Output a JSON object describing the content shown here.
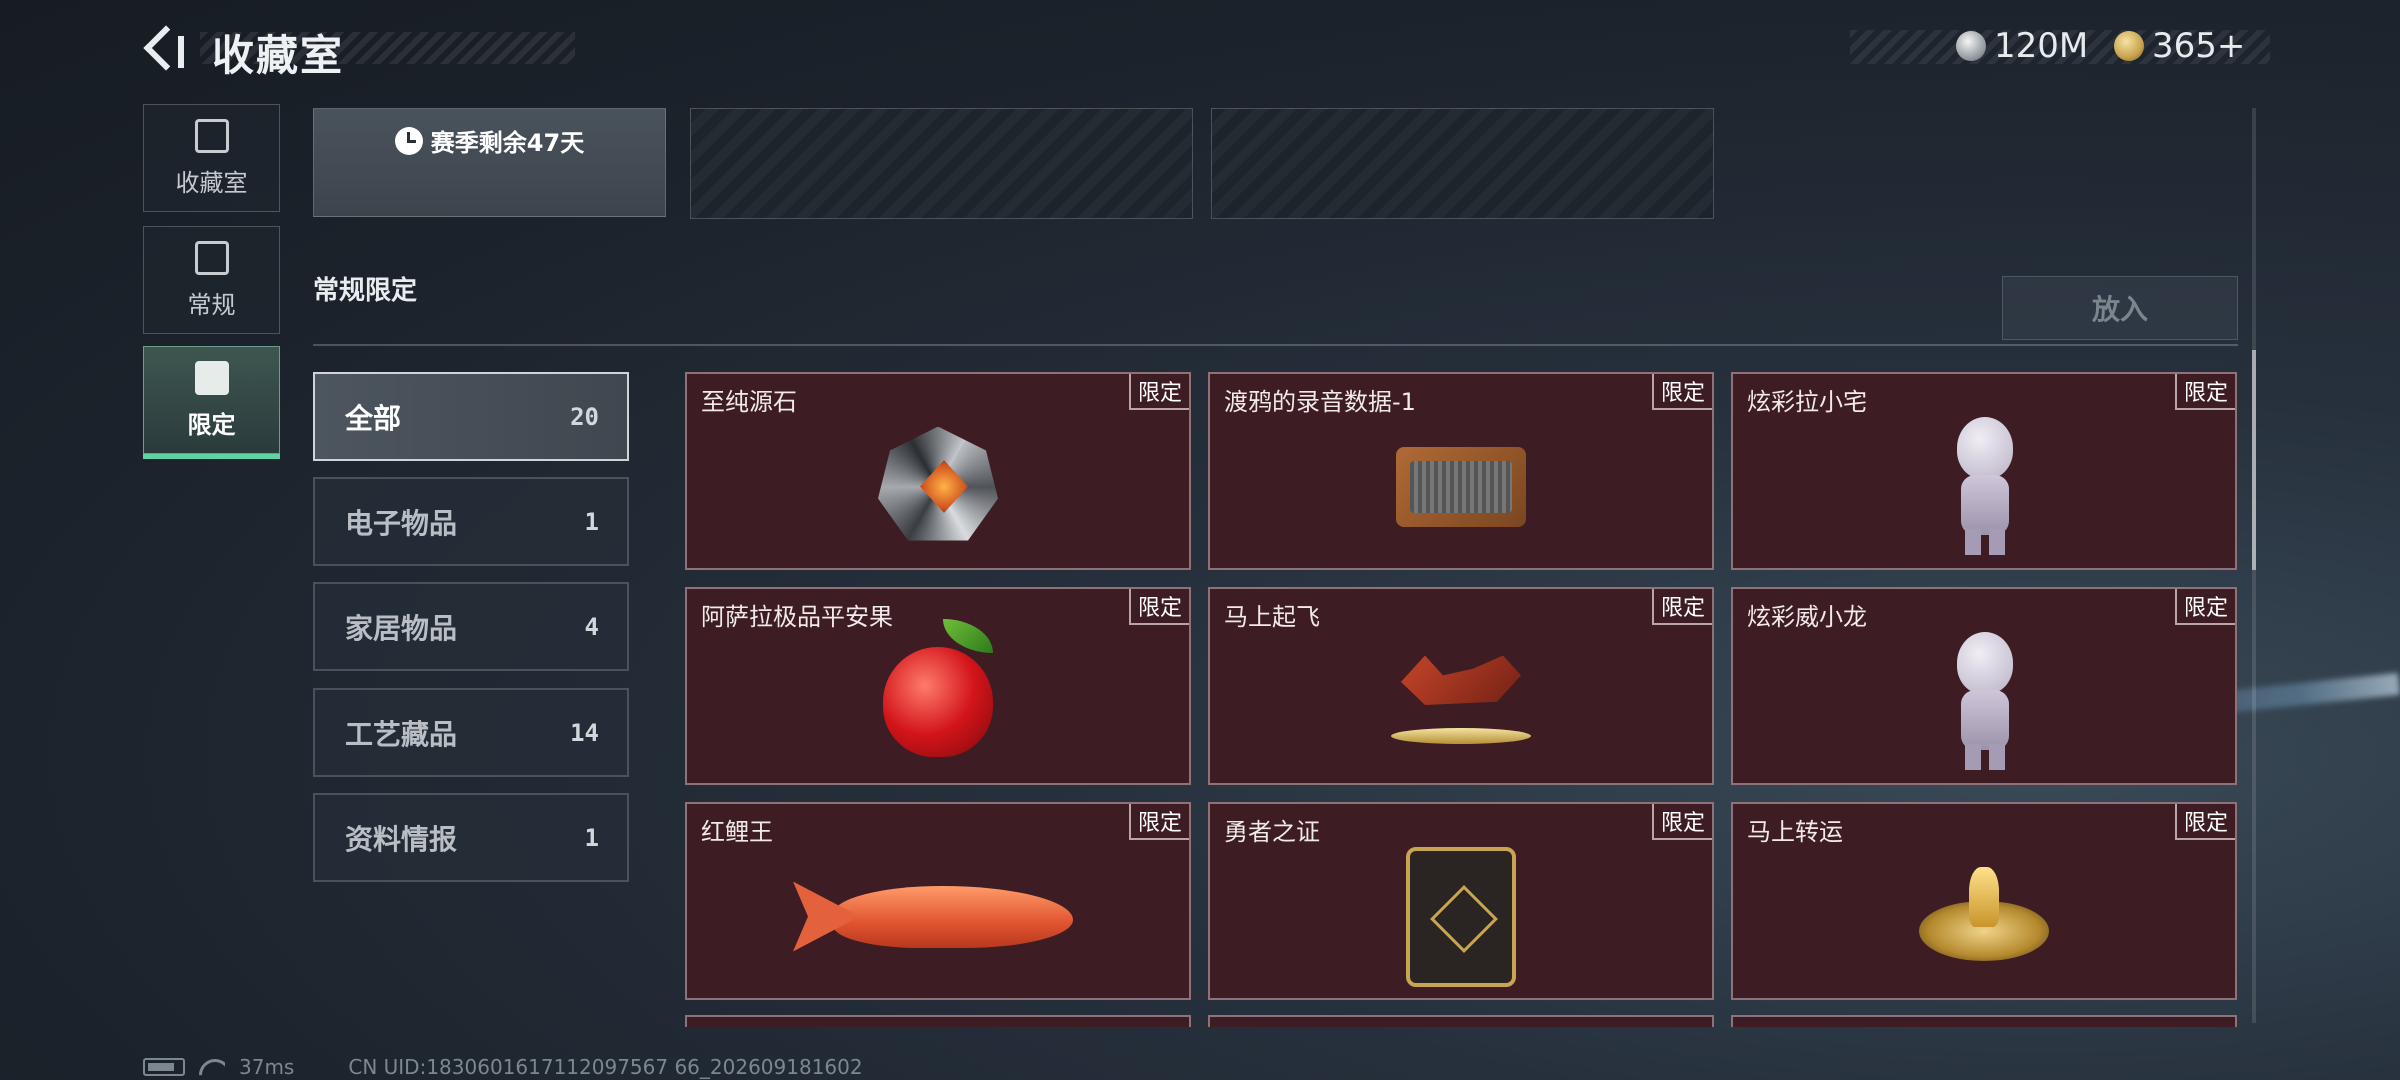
{
  "header": {
    "title": "收藏室"
  },
  "currency": [
    {
      "icon": "silver-coin-icon",
      "value": "120M"
    },
    {
      "icon": "gold-coin-icon",
      "value": "365+"
    }
  ],
  "nav": [
    {
      "label": "收藏室",
      "icon": "collection-room-icon",
      "active": false
    },
    {
      "label": "常规",
      "icon": "regular-icon",
      "active": false
    },
    {
      "label": "限定",
      "icon": "limited-icon",
      "active": true
    }
  ],
  "season": {
    "text": "赛季剩余47天",
    "icon": "clock-icon"
  },
  "section": {
    "title": "常规限定",
    "place_button": "放入"
  },
  "categories": [
    {
      "label": "全部",
      "count": "20",
      "active": true
    },
    {
      "label": "电子物品",
      "count": "1"
    },
    {
      "label": "家居物品",
      "count": "4"
    },
    {
      "label": "工艺藏品",
      "count": "14"
    },
    {
      "label": "资料情报",
      "count": "1"
    }
  ],
  "items": [
    {
      "name": "至纯源石",
      "tag": "限定",
      "icon": "crystal-stone-icon"
    },
    {
      "name": "渡鸦的录音数据-1",
      "tag": "限定",
      "icon": "cassette-tape-icon"
    },
    {
      "name": "炫彩拉小宅",
      "tag": "限定",
      "icon": "doll-figure-icon"
    },
    {
      "name": "阿萨拉极品平安果",
      "tag": "限定",
      "icon": "apple-icon"
    },
    {
      "name": "马上起飞",
      "tag": "限定",
      "icon": "horse-statue-icon"
    },
    {
      "name": "炫彩威小龙",
      "tag": "限定",
      "icon": "dragon-figure-icon"
    },
    {
      "name": "红鲤王",
      "tag": "限定",
      "icon": "carp-fish-icon"
    },
    {
      "name": "勇者之证",
      "tag": "限定",
      "icon": "badge-card-icon"
    },
    {
      "name": "马上转运",
      "tag": "限定",
      "icon": "golden-wheel-icon"
    }
  ],
  "status": {
    "ping": "37ms",
    "uid": "CN UID:1830601617112097567 66_202609181602"
  }
}
